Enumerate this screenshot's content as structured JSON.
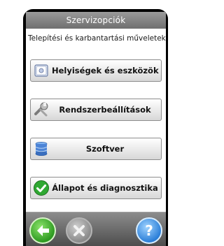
{
  "window": {
    "title": "Szervizopciók"
  },
  "header": {
    "description": "Telepítési és karbantartási műveletek."
  },
  "menu": {
    "items": [
      {
        "label": "Helyiségek és eszközök",
        "icon": "rooms-devices-icon"
      },
      {
        "label": "Rendszerbeállítások",
        "icon": "wrench-icon"
      },
      {
        "label": "Szoftver",
        "icon": "database-icon"
      },
      {
        "label": "Állapot és diagnosztika",
        "icon": "checkmark-icon"
      }
    ]
  },
  "toolbar": {
    "back": "back-arrow-icon",
    "cancel": "cancel-x-icon",
    "help": "help-question-icon"
  },
  "colors": {
    "titlebar": "#7f7f7f",
    "bottombar": "#5a5a5a",
    "back_green": "#3aa52c",
    "help_blue": "#2c7fd8"
  }
}
